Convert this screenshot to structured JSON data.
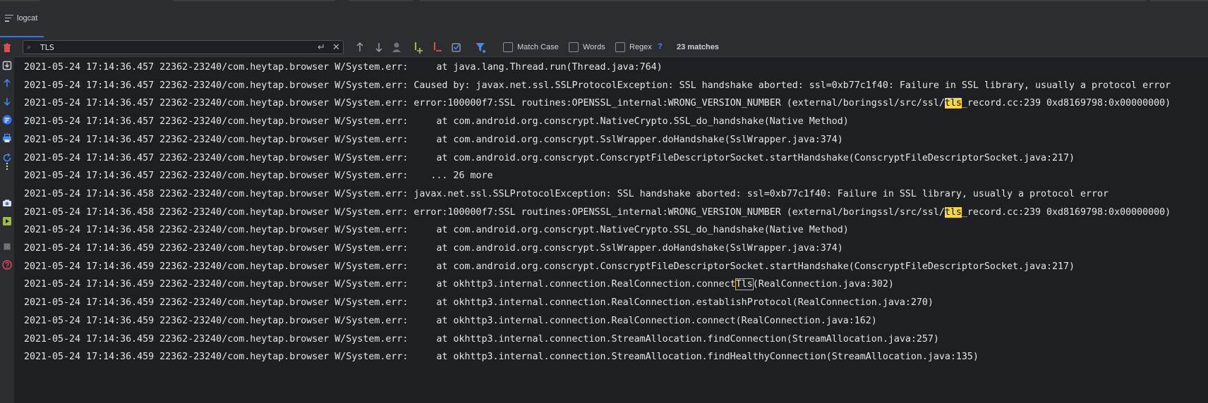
{
  "tab": {
    "label": "logcat"
  },
  "search": {
    "value": "TLS",
    "placeholder": ""
  },
  "options": {
    "match_case_label": "Match Case",
    "words_label": "Words",
    "regex_label": "Regex",
    "help": "?",
    "match_count": "23 matches"
  },
  "colors": {
    "accent": "#3574f0",
    "highlight": "#f5d93b",
    "background": "#1e1f22"
  },
  "log_lines": [
    {
      "before": "2021-05-24 17:14:36.457 22362-23240/com.heytap.browser W/System.err:     at java.lang.Thread.run(Thread.java:764)",
      "match": "",
      "after": ""
    },
    {
      "before": "2021-05-24 17:14:36.457 22362-23240/com.heytap.browser W/System.err: Caused by: javax.net.ssl.SSLProtocolException: SSL handshake aborted: ssl=0xb77c1f40: Failure in SSL library, usually a protocol error",
      "match": "",
      "after": ""
    },
    {
      "before": "2021-05-24 17:14:36.457 22362-23240/com.heytap.browser W/System.err: error:100000f7:SSL routines:OPENSSL_internal:WRONG_VERSION_NUMBER (external/boringssl/src/ssl/",
      "match": "tls",
      "after": "_record.cc:239 0xd8169798:0x00000000)"
    },
    {
      "before": "2021-05-24 17:14:36.457 22362-23240/com.heytap.browser W/System.err:     at com.android.org.conscrypt.NativeCrypto.SSL_do_handshake(Native Method)",
      "match": "",
      "after": ""
    },
    {
      "before": "2021-05-24 17:14:36.457 22362-23240/com.heytap.browser W/System.err:     at com.android.org.conscrypt.SslWrapper.doHandshake(SslWrapper.java:374)",
      "match": "",
      "after": ""
    },
    {
      "before": "2021-05-24 17:14:36.457 22362-23240/com.heytap.browser W/System.err:     at com.android.org.conscrypt.ConscryptFileDescriptorSocket.startHandshake(ConscryptFileDescriptorSocket.java:217)",
      "match": "",
      "after": ""
    },
    {
      "before": "2021-05-24 17:14:36.457 22362-23240/com.heytap.browser W/System.err:    ... 26 more",
      "match": "",
      "after": ""
    },
    {
      "before": "2021-05-24 17:14:36.458 22362-23240/com.heytap.browser W/System.err: javax.net.ssl.SSLProtocolException: SSL handshake aborted: ssl=0xb77c1f40: Failure in SSL library, usually a protocol error",
      "match": "",
      "after": ""
    },
    {
      "before": "2021-05-24 17:14:36.458 22362-23240/com.heytap.browser W/System.err: error:100000f7:SSL routines:OPENSSL_internal:WRONG_VERSION_NUMBER (external/boringssl/src/ssl/",
      "match": "tls",
      "after": "_record.cc:239 0xd8169798:0x00000000)"
    },
    {
      "before": "2021-05-24 17:14:36.458 22362-23240/com.heytap.browser W/System.err:     at com.android.org.conscrypt.NativeCrypto.SSL_do_handshake(Native Method)",
      "match": "",
      "after": ""
    },
    {
      "before": "2021-05-24 17:14:36.459 22362-23240/com.heytap.browser W/System.err:     at com.android.org.conscrypt.SslWrapper.doHandshake(SslWrapper.java:374)",
      "match": "",
      "after": ""
    },
    {
      "before": "2021-05-24 17:14:36.459 22362-23240/com.heytap.browser W/System.err:     at com.android.org.conscrypt.ConscryptFileDescriptorSocket.startHandshake(ConscryptFileDescriptorSocket.java:217)",
      "match": "",
      "after": ""
    },
    {
      "before": "2021-05-24 17:14:36.459 22362-23240/com.heytap.browser W/System.err:     at okhttp3.internal.connection.RealConnection.connect",
      "match": "Tls",
      "after": "(RealConnection.java:302)"
    },
    {
      "before": "2021-05-24 17:14:36.459 22362-23240/com.heytap.browser W/System.err:     at okhttp3.internal.connection.RealConnection.establishProtocol(RealConnection.java:270)",
      "match": "",
      "after": ""
    },
    {
      "before": "2021-05-24 17:14:36.459 22362-23240/com.heytap.browser W/System.err:     at okhttp3.internal.connection.RealConnection.connect(RealConnection.java:162)",
      "match": "",
      "after": ""
    },
    {
      "before": "2021-05-24 17:14:36.459 22362-23240/com.heytap.browser W/System.err:     at okhttp3.internal.connection.StreamAllocation.findConnection(StreamAllocation.java:257)",
      "match": "",
      "after": ""
    },
    {
      "before": "2021-05-24 17:14:36.459 22362-23240/com.heytap.browser W/System.err:     at okhttp3.internal.connection.StreamAllocation.findHealthyConnection(StreamAllocation.java:135)",
      "match": "",
      "after": ""
    }
  ]
}
